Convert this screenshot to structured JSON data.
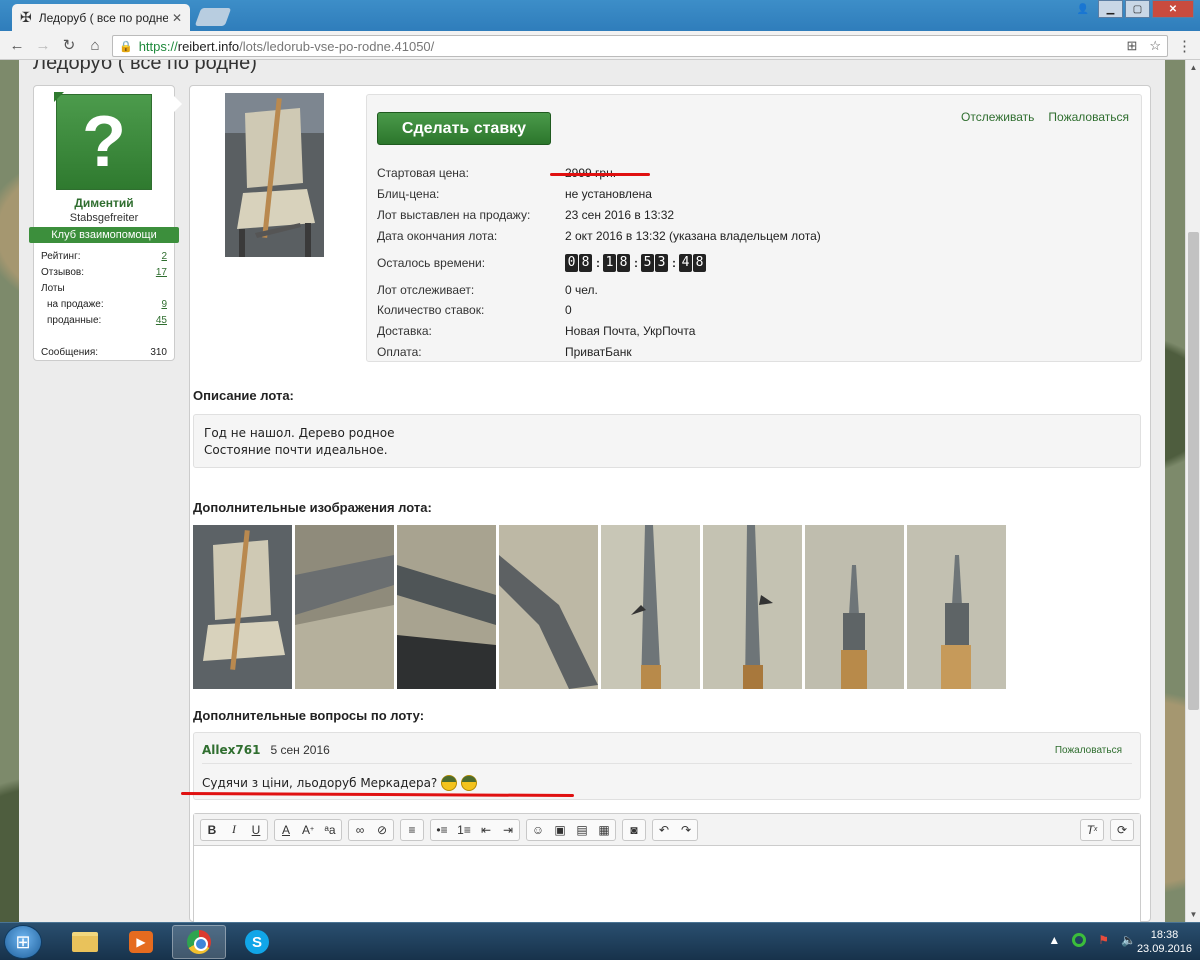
{
  "browser": {
    "tab_title": "Ледоруб ( все по родне",
    "tab_favicon": "✠",
    "tab_close": "✕",
    "url_secure": "https://",
    "url_host": "reibert.info",
    "url_path": "/lots/ledorub-vse-po-rodne.41050/"
  },
  "page": {
    "title": "Ледоруб ( все по родне)"
  },
  "seller": {
    "name": "Диментий",
    "rank": "Stabsgefreiter",
    "club": "Клуб взаимопомощи",
    "stats": [
      {
        "label": "Рейтинг:",
        "value": "2",
        "link": true,
        "sub": false
      },
      {
        "label": "Отзывов:",
        "value": "17",
        "link": true,
        "sub": false
      },
      {
        "label": "Лоты",
        "value": "",
        "link": false,
        "sub": false
      },
      {
        "label": "на продаже:",
        "value": "9",
        "link": true,
        "sub": true
      },
      {
        "label": "проданные:",
        "value": "45",
        "link": true,
        "sub": true
      },
      {
        "label": "",
        "value": "",
        "link": false,
        "sub": false
      },
      {
        "label": "Сообщения:",
        "value": "310",
        "link": false,
        "sub": false
      }
    ]
  },
  "lot": {
    "bid_button": "Сделать ставку",
    "watch_link": "Отслеживать",
    "report_link": "Пожаловаться",
    "rows": [
      {
        "label": "Стартовая цена:",
        "value": "2999 грн."
      },
      {
        "label": "Блиц-цена:",
        "value": "не установлена"
      },
      {
        "label": "Лот выставлен на продажу:",
        "value": "23 сен 2016 в 13:32"
      },
      {
        "label": "Дата окончания лота:",
        "value": "2 окт 2016 в 13:32 (указана владельцем лота)"
      }
    ],
    "timer_label": "Осталось времени:",
    "timer": [
      "08",
      "18",
      "53",
      "48"
    ],
    "rows2": [
      {
        "label": "Лот отслеживает:",
        "value": "0 чел."
      },
      {
        "label": "Количество ставок:",
        "value": "0"
      },
      {
        "label": "Доставка:",
        "value": "Новая Почта, УкрПочта"
      },
      {
        "label": "Оплата:",
        "value": "ПриватБанк"
      }
    ]
  },
  "description": {
    "heading": "Описание лота:",
    "line1": "Год не нашол. Дерево родное",
    "line2": "Состояние почти идеальное."
  },
  "extra_images": {
    "heading": "Дополнительные изображения лота:",
    "count": 8
  },
  "questions": {
    "heading": "Дополнительные вопросы по лоту:",
    "items": [
      {
        "author": "Allex761",
        "date": "5 сен 2016",
        "report": "Пожаловаться",
        "text": "Судячи з ціни, льодоруб Меркадера?"
      }
    ]
  },
  "taskbar": {
    "time": "18:38",
    "date": "23.09.2016"
  }
}
